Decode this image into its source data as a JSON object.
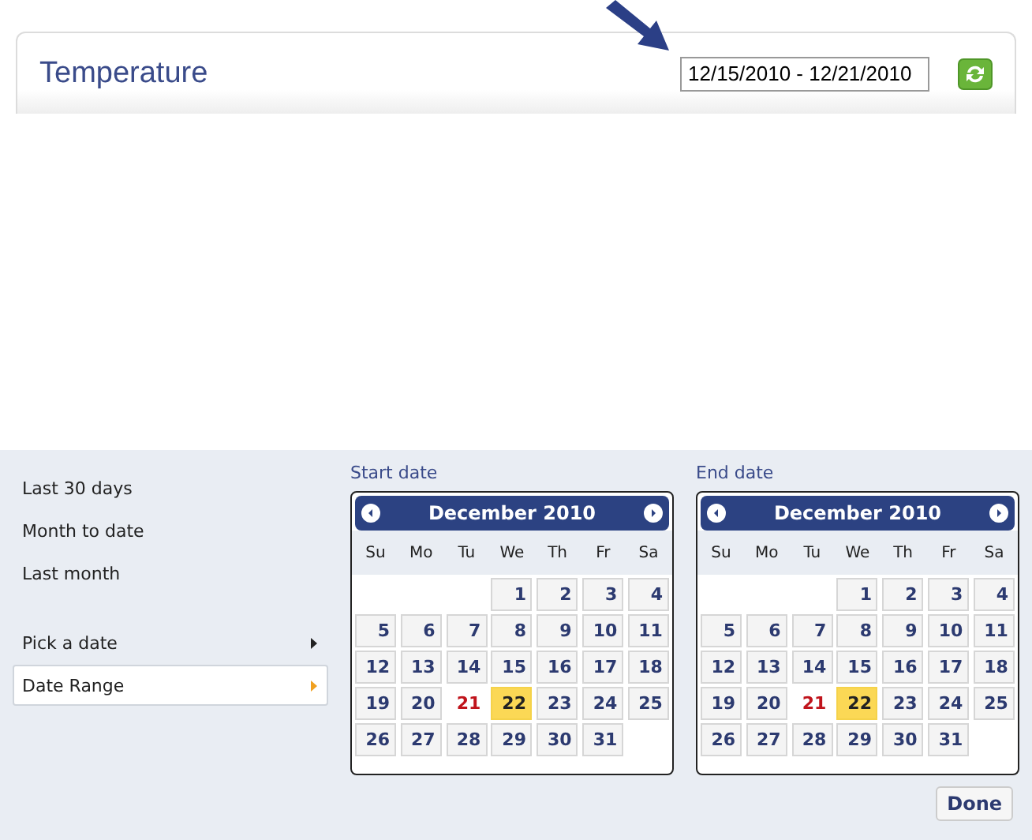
{
  "widget": {
    "title": "Temperature",
    "date_range": "12/15/2010 - 12/21/2010"
  },
  "menu": [
    {
      "label": "Last 30 days",
      "kind": "plain",
      "selected": false
    },
    {
      "label": "Month to date",
      "kind": "plain",
      "selected": false
    },
    {
      "label": "Last month",
      "kind": "plain",
      "selected": false
    },
    {
      "label": "Pick a date",
      "kind": "submenu",
      "selected": false
    },
    {
      "label": "Date Range",
      "kind": "submenu",
      "selected": true
    }
  ],
  "calendars": [
    {
      "label": "Start date",
      "month": "December 2010",
      "weekdays": [
        "Su",
        "Mo",
        "Tu",
        "We",
        "Th",
        "Fr",
        "Sa"
      ],
      "weeks": [
        [
          {
            "kind": "empty"
          },
          {
            "kind": "empty"
          },
          {
            "kind": "empty"
          },
          {
            "kind": "day",
            "label": "1",
            "selected": false,
            "today": false
          },
          {
            "kind": "day",
            "label": "2",
            "selected": false,
            "today": false
          },
          {
            "kind": "day",
            "label": "3",
            "selected": false,
            "today": false
          },
          {
            "kind": "day",
            "label": "4",
            "selected": false,
            "today": false
          }
        ],
        [
          {
            "kind": "day",
            "label": "5",
            "selected": false,
            "today": false
          },
          {
            "kind": "day",
            "label": "6",
            "selected": false,
            "today": false
          },
          {
            "kind": "day",
            "label": "7",
            "selected": false,
            "today": false
          },
          {
            "kind": "day",
            "label": "8",
            "selected": false,
            "today": false
          },
          {
            "kind": "day",
            "label": "9",
            "selected": false,
            "today": false
          },
          {
            "kind": "day",
            "label": "10",
            "selected": false,
            "today": false
          },
          {
            "kind": "day",
            "label": "11",
            "selected": false,
            "today": false
          }
        ],
        [
          {
            "kind": "day",
            "label": "12",
            "selected": false,
            "today": false
          },
          {
            "kind": "day",
            "label": "13",
            "selected": false,
            "today": false
          },
          {
            "kind": "day",
            "label": "14",
            "selected": false,
            "today": false
          },
          {
            "kind": "day",
            "label": "15",
            "selected": false,
            "today": false
          },
          {
            "kind": "day",
            "label": "16",
            "selected": false,
            "today": false
          },
          {
            "kind": "day",
            "label": "17",
            "selected": false,
            "today": false
          },
          {
            "kind": "day",
            "label": "18",
            "selected": false,
            "today": false
          }
        ],
        [
          {
            "kind": "day",
            "label": "19",
            "selected": false,
            "today": false
          },
          {
            "kind": "day",
            "label": "20",
            "selected": false,
            "today": false
          },
          {
            "kind": "day",
            "label": "21",
            "selected": false,
            "today": true
          },
          {
            "kind": "day",
            "label": "22",
            "selected": true,
            "today": false
          },
          {
            "kind": "day",
            "label": "23",
            "selected": false,
            "today": false
          },
          {
            "kind": "day",
            "label": "24",
            "selected": false,
            "today": false
          },
          {
            "kind": "day",
            "label": "25",
            "selected": false,
            "today": false
          }
        ],
        [
          {
            "kind": "day",
            "label": "26",
            "selected": false,
            "today": false
          },
          {
            "kind": "day",
            "label": "27",
            "selected": false,
            "today": false
          },
          {
            "kind": "day",
            "label": "28",
            "selected": false,
            "today": false
          },
          {
            "kind": "day",
            "label": "29",
            "selected": false,
            "today": false
          },
          {
            "kind": "day",
            "label": "30",
            "selected": false,
            "today": false
          },
          {
            "kind": "day",
            "label": "31",
            "selected": false,
            "today": false
          },
          {
            "kind": "empty"
          }
        ]
      ]
    },
    {
      "label": "End date",
      "month": "December 2010",
      "weekdays": [
        "Su",
        "Mo",
        "Tu",
        "We",
        "Th",
        "Fr",
        "Sa"
      ],
      "weeks": [
        [
          {
            "kind": "empty"
          },
          {
            "kind": "empty"
          },
          {
            "kind": "empty"
          },
          {
            "kind": "day",
            "label": "1",
            "selected": false,
            "today": false
          },
          {
            "kind": "day",
            "label": "2",
            "selected": false,
            "today": false
          },
          {
            "kind": "day",
            "label": "3",
            "selected": false,
            "today": false
          },
          {
            "kind": "day",
            "label": "4",
            "selected": false,
            "today": false
          }
        ],
        [
          {
            "kind": "day",
            "label": "5",
            "selected": false,
            "today": false
          },
          {
            "kind": "day",
            "label": "6",
            "selected": false,
            "today": false
          },
          {
            "kind": "day",
            "label": "7",
            "selected": false,
            "today": false
          },
          {
            "kind": "day",
            "label": "8",
            "selected": false,
            "today": false
          },
          {
            "kind": "day",
            "label": "9",
            "selected": false,
            "today": false
          },
          {
            "kind": "day",
            "label": "10",
            "selected": false,
            "today": false
          },
          {
            "kind": "day",
            "label": "11",
            "selected": false,
            "today": false
          }
        ],
        [
          {
            "kind": "day",
            "label": "12",
            "selected": false,
            "today": false
          },
          {
            "kind": "day",
            "label": "13",
            "selected": false,
            "today": false
          },
          {
            "kind": "day",
            "label": "14",
            "selected": false,
            "today": false
          },
          {
            "kind": "day",
            "label": "15",
            "selected": false,
            "today": false
          },
          {
            "kind": "day",
            "label": "16",
            "selected": false,
            "today": false
          },
          {
            "kind": "day",
            "label": "17",
            "selected": false,
            "today": false
          },
          {
            "kind": "day",
            "label": "18",
            "selected": false,
            "today": false
          }
        ],
        [
          {
            "kind": "day",
            "label": "19",
            "selected": false,
            "today": false
          },
          {
            "kind": "day",
            "label": "20",
            "selected": false,
            "today": false
          },
          {
            "kind": "day",
            "label": "21",
            "selected": false,
            "today": true
          },
          {
            "kind": "day",
            "label": "22",
            "selected": true,
            "today": false
          },
          {
            "kind": "day",
            "label": "23",
            "selected": false,
            "today": false
          },
          {
            "kind": "day",
            "label": "24",
            "selected": false,
            "today": false
          },
          {
            "kind": "day",
            "label": "25",
            "selected": false,
            "today": false
          }
        ],
        [
          {
            "kind": "day",
            "label": "26",
            "selected": false,
            "today": false
          },
          {
            "kind": "day",
            "label": "27",
            "selected": false,
            "today": false
          },
          {
            "kind": "day",
            "label": "28",
            "selected": false,
            "today": false
          },
          {
            "kind": "day",
            "label": "29",
            "selected": false,
            "today": false
          },
          {
            "kind": "day",
            "label": "30",
            "selected": false,
            "today": false
          },
          {
            "kind": "day",
            "label": "31",
            "selected": false,
            "today": false
          },
          {
            "kind": "empty"
          }
        ]
      ]
    }
  ],
  "done_button": "Done"
}
